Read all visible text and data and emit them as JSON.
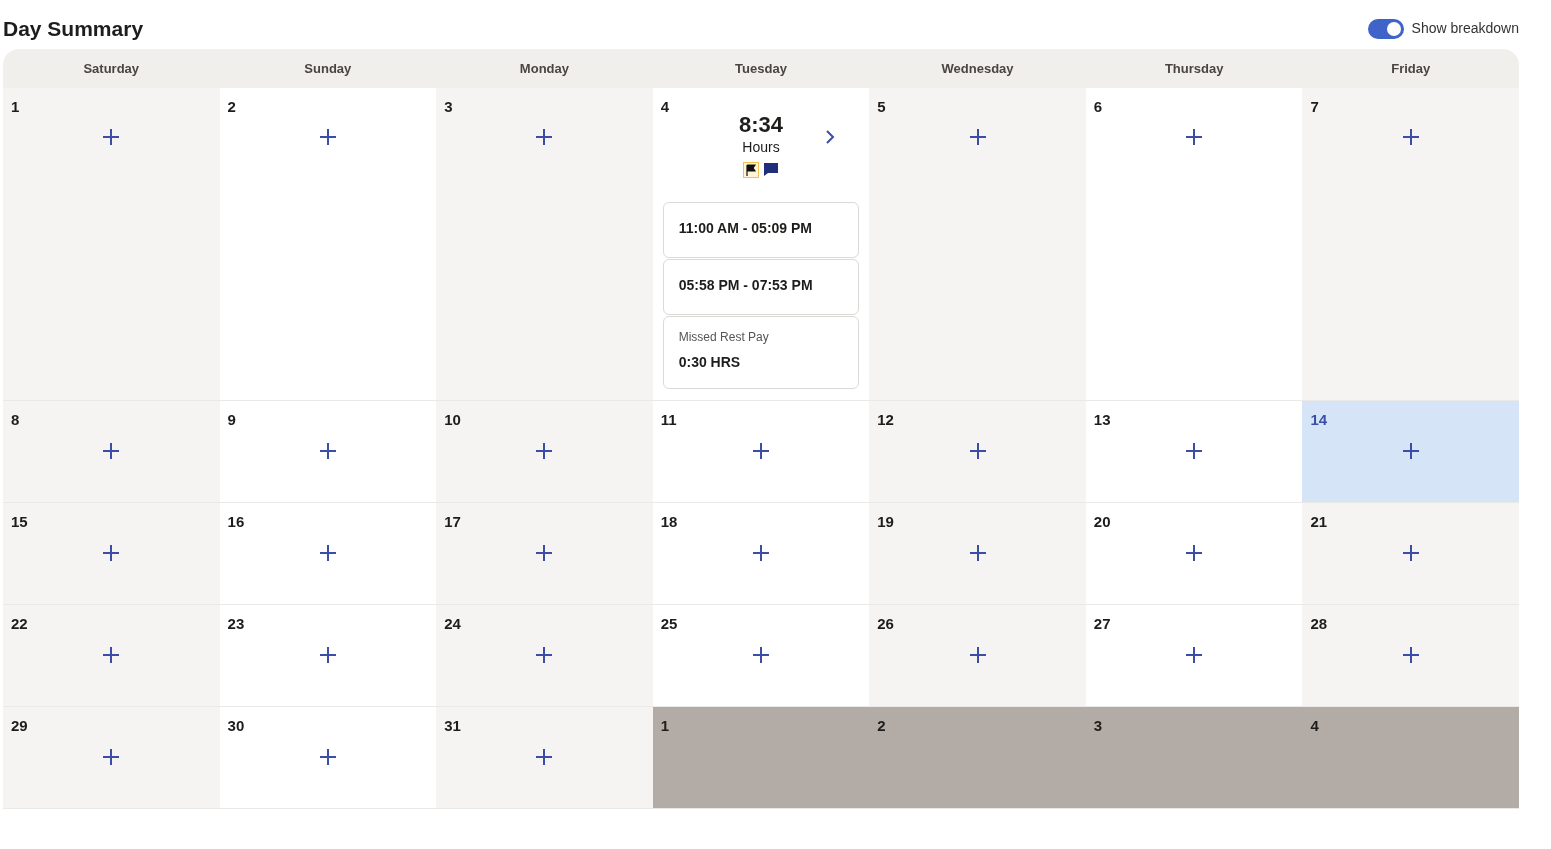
{
  "title": "Day Summary",
  "toggle": {
    "label": "Show breakdown",
    "on": true
  },
  "weekdays": [
    "Saturday",
    "Sunday",
    "Monday",
    "Tuesday",
    "Wednesday",
    "Thursday",
    "Friday"
  ],
  "weeks": [
    [
      {
        "day": "1",
        "kind": "day",
        "today": false
      },
      {
        "day": "2",
        "kind": "day",
        "today": false
      },
      {
        "day": "3",
        "kind": "day",
        "today": false
      },
      {
        "day": "4",
        "kind": "summary",
        "today": false,
        "summary": {
          "hours": "8:34",
          "unit": "Hours",
          "entries": [
            {
              "kind": "shift",
              "text": "11:00 AM - 05:09 PM"
            },
            {
              "kind": "shift",
              "text": "05:58 PM - 07:53 PM"
            },
            {
              "kind": "pay",
              "label": "Missed Rest Pay",
              "value": "0:30 HRS"
            }
          ]
        }
      },
      {
        "day": "5",
        "kind": "day",
        "today": false
      },
      {
        "day": "6",
        "kind": "day",
        "today": false
      },
      {
        "day": "7",
        "kind": "day",
        "today": false
      }
    ],
    [
      {
        "day": "8",
        "kind": "day",
        "today": false
      },
      {
        "day": "9",
        "kind": "day",
        "today": false
      },
      {
        "day": "10",
        "kind": "day",
        "today": false
      },
      {
        "day": "11",
        "kind": "day",
        "today": false
      },
      {
        "day": "12",
        "kind": "day",
        "today": false
      },
      {
        "day": "13",
        "kind": "day",
        "today": false
      },
      {
        "day": "14",
        "kind": "day",
        "today": true
      }
    ],
    [
      {
        "day": "15",
        "kind": "day",
        "today": false
      },
      {
        "day": "16",
        "kind": "day",
        "today": false
      },
      {
        "day": "17",
        "kind": "day",
        "today": false
      },
      {
        "day": "18",
        "kind": "day",
        "today": false
      },
      {
        "day": "19",
        "kind": "day",
        "today": false
      },
      {
        "day": "20",
        "kind": "day",
        "today": false
      },
      {
        "day": "21",
        "kind": "day",
        "today": false
      }
    ],
    [
      {
        "day": "22",
        "kind": "day",
        "today": false
      },
      {
        "day": "23",
        "kind": "day",
        "today": false
      },
      {
        "day": "24",
        "kind": "day",
        "today": false
      },
      {
        "day": "25",
        "kind": "day",
        "today": false
      },
      {
        "day": "26",
        "kind": "day",
        "today": false
      },
      {
        "day": "27",
        "kind": "day",
        "today": false
      },
      {
        "day": "28",
        "kind": "day",
        "today": false
      }
    ],
    [
      {
        "day": "29",
        "kind": "day",
        "today": false
      },
      {
        "day": "30",
        "kind": "day",
        "today": false
      },
      {
        "day": "31",
        "kind": "day",
        "today": false
      },
      {
        "day": "1",
        "kind": "outside",
        "today": false
      },
      {
        "day": "2",
        "kind": "outside",
        "today": false
      },
      {
        "day": "3",
        "kind": "outside",
        "today": false
      },
      {
        "day": "4",
        "kind": "outside",
        "today": false
      }
    ]
  ]
}
